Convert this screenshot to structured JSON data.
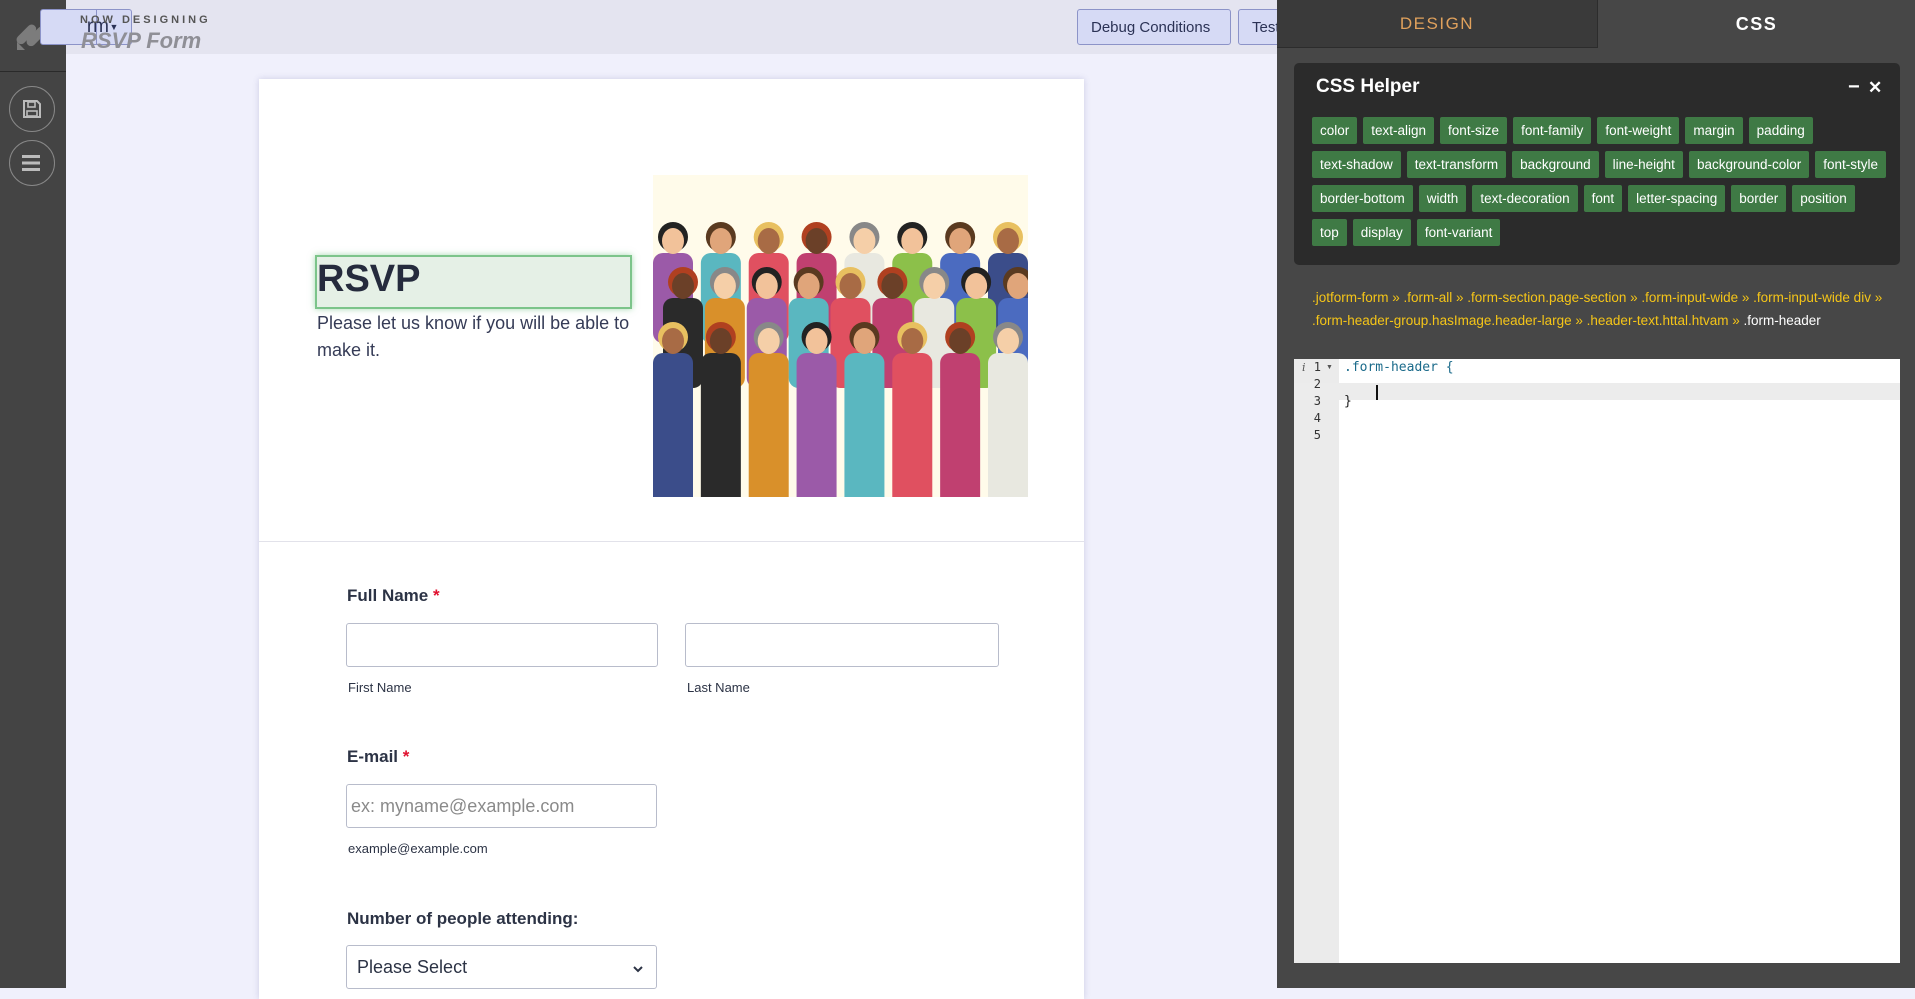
{
  "topbar": {
    "form_dropdown_fragment": "rm",
    "now_designing": "NOW DESIGNING",
    "form_name": "RSVP Form",
    "debug_button": "Debug Conditions",
    "test_button": "Test"
  },
  "sidebar": {
    "icons": [
      "logo-icon",
      "save-icon",
      "menu-icon"
    ]
  },
  "form": {
    "header": {
      "title": "RSVP",
      "subtitle": "Please let us know if you will be able to make it."
    },
    "full_name": {
      "label": "Full Name",
      "required": "*",
      "first_sub": "First Name",
      "last_sub": "Last Name",
      "first_value": "",
      "last_value": ""
    },
    "email": {
      "label": "E-mail",
      "required": "*",
      "placeholder": "ex: myname@example.com",
      "sublabel": "example@example.com"
    },
    "attendees": {
      "label": "Number of people attending:",
      "selected": "Please Select"
    }
  },
  "panel": {
    "tabs": [
      {
        "label": "DESIGN"
      },
      {
        "label": "CSS"
      }
    ],
    "helper": {
      "title": "CSS Helper",
      "minimize": "−",
      "close": "✕",
      "chips": [
        "color",
        "text-align",
        "font-size",
        "font-family",
        "font-weight",
        "margin",
        "padding",
        "text-shadow",
        "text-transform",
        "background",
        "line-height",
        "background-color",
        "font-style",
        "border-bottom",
        "width",
        "text-decoration",
        "font",
        "letter-spacing",
        "border",
        "position",
        "top",
        "display",
        "font-variant"
      ]
    },
    "breadcrumb": {
      "path": ".jotform-form » .form-all » .form-section.page-section » .form-input-wide » .form-input-wide div » .form-header-group.hasImage.header-large » .header-text.httal.htvam » ",
      "current": ".form-header"
    },
    "editor": {
      "lines": [
        ".form-header {",
        "    ",
        "}",
        "",
        ""
      ],
      "line_numbers": [
        "1",
        "2",
        "3",
        "4",
        "5"
      ]
    }
  },
  "colors": {
    "accent_green": "#3f7a45",
    "tab_design": "#e0a15c",
    "crumb": "#f5c518",
    "required": "#e0102e"
  }
}
